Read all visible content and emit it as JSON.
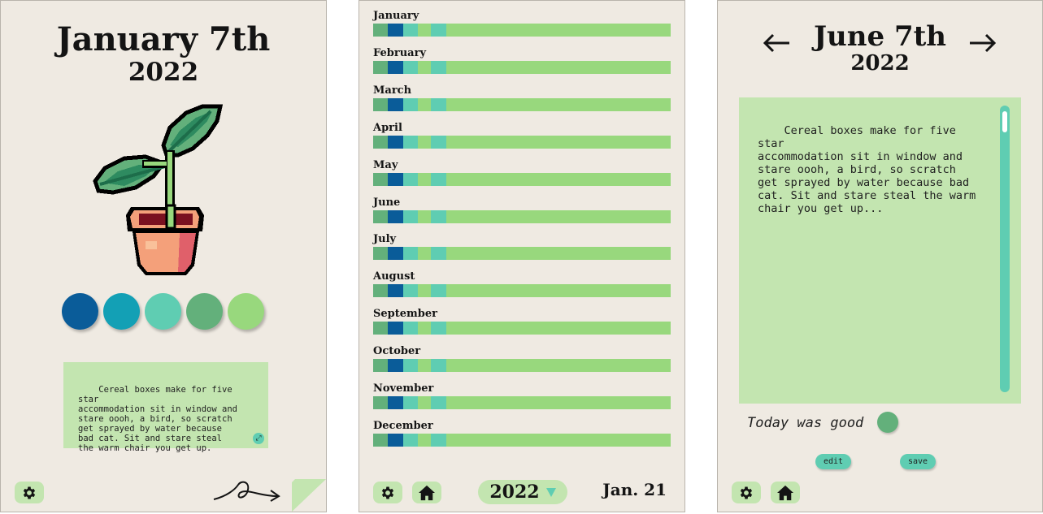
{
  "colors": {
    "panel_bg": "#efeae2",
    "light_green": "#c3e5b0",
    "teal": "#5fcdb2",
    "navy": "#0a5c99",
    "cyan": "#13a0b5",
    "mid_green": "#63b07b",
    "lime": "#98d87d"
  },
  "journal_view": {
    "date": "January 7th",
    "year": "2022",
    "image": "pixel-plant-in-pot",
    "mood_swatches": [
      "#0a5c99",
      "#13a0b5",
      "#5fcdb2",
      "#63b07b",
      "#98d87d"
    ],
    "note": "Cereal boxes make for five star\naccommodation sit in window and\nstare oooh, a bird, so scratch\nget sprayed by water because\nbad cat. Sit and stare steal\nthe warm chair you get up.",
    "icons": {
      "settings": "gear-icon",
      "expand": "expand-icon",
      "next": "swirl-arrow-icon"
    }
  },
  "year_view": {
    "months": [
      {
        "name": "January"
      },
      {
        "name": "February"
      },
      {
        "name": "March"
      },
      {
        "name": "April"
      },
      {
        "name": "May"
      },
      {
        "name": "June"
      },
      {
        "name": "July"
      },
      {
        "name": "August"
      },
      {
        "name": "September"
      },
      {
        "name": "October"
      },
      {
        "name": "November"
      },
      {
        "name": "December"
      }
    ],
    "bar_segments": [
      {
        "color": "#63b07b",
        "share": 0.05
      },
      {
        "color": "#0a5c99",
        "share": 0.05
      },
      {
        "color": "#5fcdb2",
        "share": 0.05
      },
      {
        "color": "#98d87d",
        "share": 0.045
      },
      {
        "color": "#5fcdb2",
        "share": 0.05
      },
      {
        "color": "#98d87d",
        "share": 0.755
      }
    ],
    "year_selector": "2022",
    "today_label": "Jan. 21"
  },
  "entry_view": {
    "date": "June 7th",
    "year": "2022",
    "text": "Cereal boxes make for five star\naccommodation sit in window and\nstare oooh, a bird, so scratch\nget sprayed by water because bad\ncat. Sit and stare steal the warm\nchair you get up...",
    "mood_label": "Today was good",
    "mood_color": "#63b07b",
    "edit_label": "edit",
    "save_label": "save"
  }
}
